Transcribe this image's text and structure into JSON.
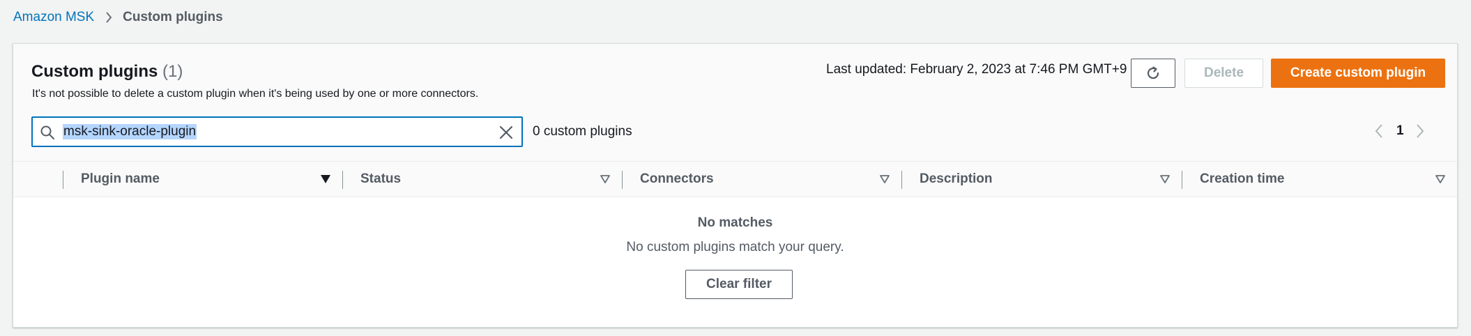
{
  "breadcrumb": {
    "parent": "Amazon MSK",
    "current": "Custom plugins"
  },
  "panel": {
    "title": "Custom plugins",
    "count": "(1)",
    "description": "It's not possible to delete a custom plugin when it's being used by one or more connectors.",
    "last_updated": "Last updated: February 2, 2023 at 7:46 PM GMT+9",
    "delete_label": "Delete",
    "create_label": "Create custom plugin"
  },
  "search": {
    "value": "msk-sink-oracle-plugin",
    "match_count": "0 custom plugins"
  },
  "pagination": {
    "current_page": "1"
  },
  "table": {
    "columns": [
      {
        "label": "Plugin name",
        "sorted": true
      },
      {
        "label": "Status",
        "sorted": false
      },
      {
        "label": "Connectors",
        "sorted": false
      },
      {
        "label": "Description",
        "sorted": false
      },
      {
        "label": "Creation time",
        "sorted": false
      }
    ]
  },
  "empty_state": {
    "title": "No matches",
    "description": "No custom plugins match your query.",
    "button_label": "Clear filter"
  },
  "colors": {
    "link": "#0073bb",
    "primary_button": "#ec7211",
    "focus_border": "#0073bb",
    "text_secondary": "#545b64"
  },
  "icons": {
    "breadcrumb_separator": "chevron-right-icon",
    "refresh": "refresh-icon",
    "search": "search-icon",
    "clear": "close-icon",
    "prev": "chevron-left-icon",
    "next": "chevron-right-icon",
    "sort": "caret-down-icon"
  }
}
